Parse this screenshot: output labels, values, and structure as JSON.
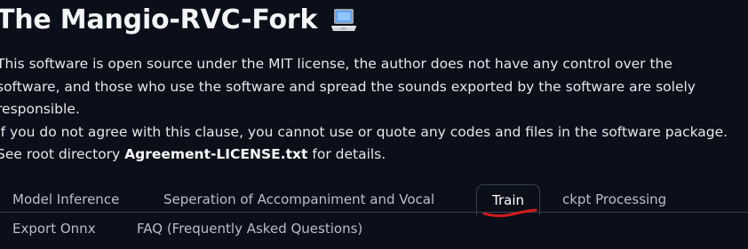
{
  "header": {
    "title": "The Mangio-RVC-Fork",
    "title_icon": "laptop-icon"
  },
  "notice": {
    "line1": "This software is open source under the MIT license, the author does not have any control over the",
    "line2": "software, and those who use the software and spread the sounds exported by the software are solely",
    "line3": "responsible.",
    "line4": "If you do not agree with this clause, you cannot use or quote any codes and files in the software package.",
    "line5_prefix": "See root directory ",
    "line5_strong": "Agreement-LICENSE.txt",
    "line5_suffix": " for details."
  },
  "tabs": {
    "items": [
      {
        "label": "Model Inference",
        "selected": false
      },
      {
        "label": "Seperation of Accompaniment and Vocal",
        "selected": false
      },
      {
        "label": "Train",
        "selected": true
      },
      {
        "label": "ckpt Processing",
        "selected": false
      },
      {
        "label": "Export Onnx",
        "selected": false
      },
      {
        "label": "FAQ (Frequently Asked Questions)",
        "selected": false
      }
    ]
  },
  "colors": {
    "background": "#0b0f19",
    "text": "#e5e7eb",
    "tab_text": "#b7bfca",
    "selected_tab_text": "#ffffff",
    "tab_border": "#374151",
    "annotation_red": "#d11a1a"
  }
}
